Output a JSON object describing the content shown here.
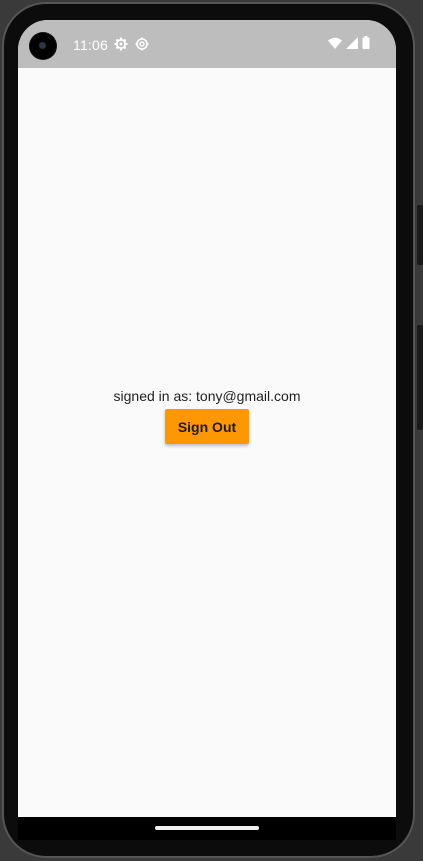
{
  "status_bar": {
    "time": "11:06",
    "left_icons": [
      "settings-gear-icon",
      "sync-gear-icon"
    ],
    "right_icons": [
      "wifi-icon",
      "cell-signal-icon",
      "battery-icon"
    ],
    "background_color": "#bdbdbd"
  },
  "main": {
    "signed_in_text": "signed in as: tony@gmail.com",
    "sign_out_label": "Sign Out",
    "accent_color": "#ff9800",
    "background_color": "#fafafa"
  }
}
